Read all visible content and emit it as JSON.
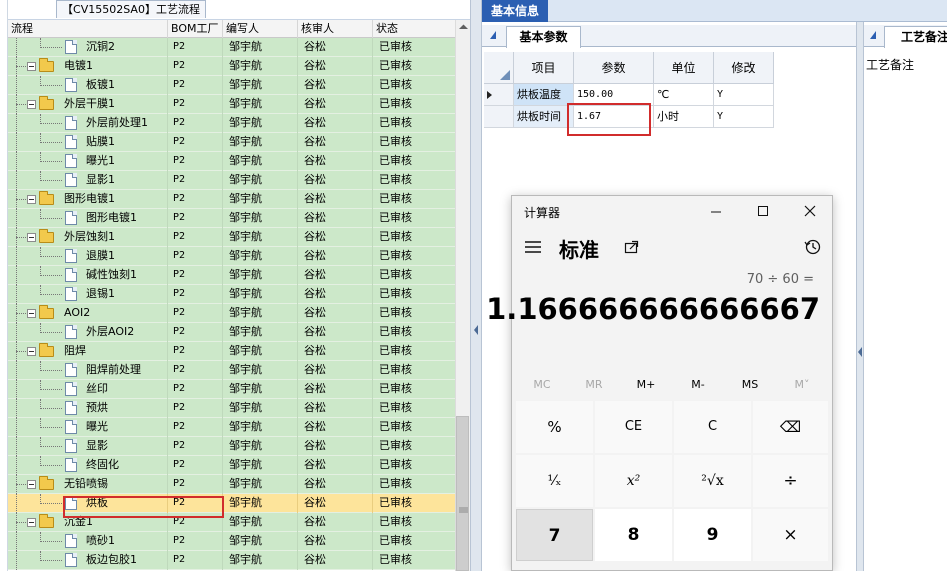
{
  "left_panel": {
    "tab_title": "【CV15502SA0】工艺流程",
    "columns": [
      "流程",
      "BOM工厂",
      "编写人",
      "核审人",
      "状态"
    ],
    "rows": [
      {
        "label": "沉铜2",
        "level": 2,
        "type": "doc",
        "bom": "P2",
        "writer": "邹宇航",
        "reviewer": "谷松",
        "status": "已审核"
      },
      {
        "label": "电镀1",
        "level": 1,
        "type": "folder",
        "bom": "P2",
        "writer": "邹宇航",
        "reviewer": "谷松",
        "status": "已审核"
      },
      {
        "label": "板镀1",
        "level": 2,
        "type": "doc",
        "bom": "P2",
        "writer": "邹宇航",
        "reviewer": "谷松",
        "status": "已审核"
      },
      {
        "label": "外层干膜1",
        "level": 1,
        "type": "folder",
        "bom": "P2",
        "writer": "邹宇航",
        "reviewer": "谷松",
        "status": "已审核"
      },
      {
        "label": "外层前处理1",
        "level": 2,
        "type": "doc",
        "bom": "P2",
        "writer": "邹宇航",
        "reviewer": "谷松",
        "status": "已审核"
      },
      {
        "label": "贴膜1",
        "level": 2,
        "type": "doc",
        "bom": "P2",
        "writer": "邹宇航",
        "reviewer": "谷松",
        "status": "已审核"
      },
      {
        "label": "曝光1",
        "level": 2,
        "type": "doc",
        "bom": "P2",
        "writer": "邹宇航",
        "reviewer": "谷松",
        "status": "已审核"
      },
      {
        "label": "显影1",
        "level": 2,
        "type": "doc",
        "bom": "P2",
        "writer": "邹宇航",
        "reviewer": "谷松",
        "status": "已审核"
      },
      {
        "label": "图形电镀1",
        "level": 1,
        "type": "folder",
        "bom": "P2",
        "writer": "邹宇航",
        "reviewer": "谷松",
        "status": "已审核"
      },
      {
        "label": "图形电镀1",
        "level": 2,
        "type": "doc",
        "bom": "P2",
        "writer": "邹宇航",
        "reviewer": "谷松",
        "status": "已审核"
      },
      {
        "label": "外层蚀刻1",
        "level": 1,
        "type": "folder",
        "bom": "P2",
        "writer": "邹宇航",
        "reviewer": "谷松",
        "status": "已审核"
      },
      {
        "label": "退膜1",
        "level": 2,
        "type": "doc",
        "bom": "P2",
        "writer": "邹宇航",
        "reviewer": "谷松",
        "status": "已审核"
      },
      {
        "label": "碱性蚀刻1",
        "level": 2,
        "type": "doc",
        "bom": "P2",
        "writer": "邹宇航",
        "reviewer": "谷松",
        "status": "已审核"
      },
      {
        "label": "退锡1",
        "level": 2,
        "type": "doc",
        "bom": "P2",
        "writer": "邹宇航",
        "reviewer": "谷松",
        "status": "已审核"
      },
      {
        "label": "AOI2",
        "level": 1,
        "type": "folder",
        "bom": "P2",
        "writer": "邹宇航",
        "reviewer": "谷松",
        "status": "已审核"
      },
      {
        "label": "外层AOI2",
        "level": 2,
        "type": "doc",
        "bom": "P2",
        "writer": "邹宇航",
        "reviewer": "谷松",
        "status": "已审核"
      },
      {
        "label": "阻焊",
        "level": 1,
        "type": "folder",
        "bom": "P2",
        "writer": "邹宇航",
        "reviewer": "谷松",
        "status": "已审核"
      },
      {
        "label": "阻焊前处理",
        "level": 2,
        "type": "doc",
        "bom": "P2",
        "writer": "邹宇航",
        "reviewer": "谷松",
        "status": "已审核"
      },
      {
        "label": "丝印",
        "level": 2,
        "type": "doc",
        "bom": "P2",
        "writer": "邹宇航",
        "reviewer": "谷松",
        "status": "已审核"
      },
      {
        "label": "预烘",
        "level": 2,
        "type": "doc",
        "bom": "P2",
        "writer": "邹宇航",
        "reviewer": "谷松",
        "status": "已审核"
      },
      {
        "label": "曝光",
        "level": 2,
        "type": "doc",
        "bom": "P2",
        "writer": "邹宇航",
        "reviewer": "谷松",
        "status": "已审核"
      },
      {
        "label": "显影",
        "level": 2,
        "type": "doc",
        "bom": "P2",
        "writer": "邹宇航",
        "reviewer": "谷松",
        "status": "已审核"
      },
      {
        "label": "终固化",
        "level": 2,
        "type": "doc",
        "bom": "P2",
        "writer": "邹宇航",
        "reviewer": "谷松",
        "status": "已审核"
      },
      {
        "label": "无铅喷锡",
        "level": 1,
        "type": "folder",
        "bom": "P2",
        "writer": "邹宇航",
        "reviewer": "谷松",
        "status": "已审核"
      },
      {
        "label": "烘板",
        "level": 2,
        "type": "doc",
        "bom": "P2",
        "writer": "邹宇航",
        "reviewer": "谷松",
        "status": "已审核",
        "selected": true
      },
      {
        "label": "沉金1",
        "level": 1,
        "type": "folder",
        "bom": "P2",
        "writer": "邹宇航",
        "reviewer": "谷松",
        "status": "已审核"
      },
      {
        "label": "喷砂1",
        "level": 2,
        "type": "doc",
        "bom": "P2",
        "writer": "邹宇航",
        "reviewer": "谷松",
        "status": "已审核"
      },
      {
        "label": "板边包胶1",
        "level": 2,
        "type": "doc",
        "bom": "P2",
        "writer": "邹宇航",
        "reviewer": "谷松",
        "status": "已审核"
      }
    ]
  },
  "middle_panel": {
    "top_tab": "基本信息",
    "sub_tab": "基本参数",
    "columns": [
      "项目",
      "参数",
      "单位",
      "修改"
    ],
    "rows": [
      {
        "item": "烘板温度",
        "param": "150.00",
        "unit": "℃",
        "edit": "Y"
      },
      {
        "item": "烘板时间",
        "param": "1.67",
        "unit": "小时",
        "edit": "Y"
      }
    ]
  },
  "right_panel": {
    "tab": "工艺备注",
    "label": "工艺备注"
  },
  "calculator": {
    "title": "计算器",
    "mode": "标准",
    "expression": "70 ÷ 60 =",
    "display": "1.166666666666667",
    "memory": [
      "MC",
      "MR",
      "M+",
      "M-",
      "MS",
      "M˅"
    ],
    "row1": [
      "%",
      "CE",
      "C",
      "⌫"
    ],
    "row2": [
      "¹⁄ₓ",
      "x²",
      "²√x",
      "÷"
    ],
    "row3": [
      "7",
      "8",
      "9",
      "×"
    ]
  },
  "colors": {
    "row_green": "#cce8c9",
    "row_selected": "#fde49b",
    "highlight_red": "#d12c2c",
    "tab_blue": "#2b5fb2"
  }
}
